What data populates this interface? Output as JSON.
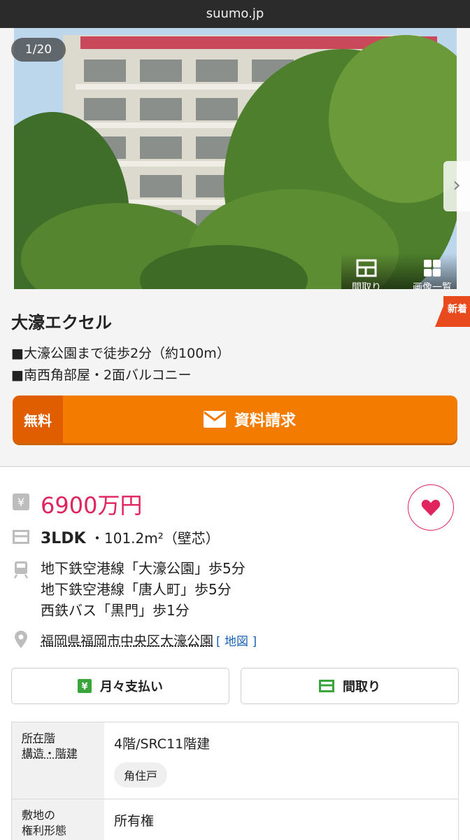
{
  "browser": {
    "url": "suumo.jp"
  },
  "gallery": {
    "counter": "1/20",
    "tools": [
      {
        "label": "間取り",
        "icon": "floorplan-icon"
      },
      {
        "label": "画像一覧",
        "icon": "grid-icon"
      }
    ]
  },
  "property": {
    "badge": "新着",
    "name": "大濠エクセル",
    "catch_lines": [
      "■大濠公園まで徒歩2分（約100m）",
      "■南西角部屋・2面バルコニー"
    ],
    "cta": {
      "free": "無料",
      "label": "資料請求"
    },
    "price": "6900万円",
    "layout": "3LDK",
    "area": "・101.2m²（壁芯）",
    "access": [
      "地下鉄空港線「大濠公園」歩5分",
      "地下鉄空港線「唐人町」歩5分",
      "西鉄バス「黒門」歩1分"
    ],
    "address": "福岡県福岡市中央区大濠公園",
    "map_link": "[ 地図 ]",
    "buttons": {
      "payment": "月々支払い",
      "floorplan": "間取り"
    }
  },
  "table": {
    "rows": [
      {
        "h1": "所在階",
        "h2": "構造・階建",
        "value": "4階/SRC11階建",
        "tag": "角住戸"
      },
      {
        "h1": "敷地の",
        "h2": "権利形態",
        "value": "所有権"
      }
    ]
  },
  "colors": {
    "accent": "#e0245e",
    "cta": "#f27b00",
    "badge": "#e8491d",
    "link": "#1a62b9",
    "icon_green": "#3aa53a"
  }
}
